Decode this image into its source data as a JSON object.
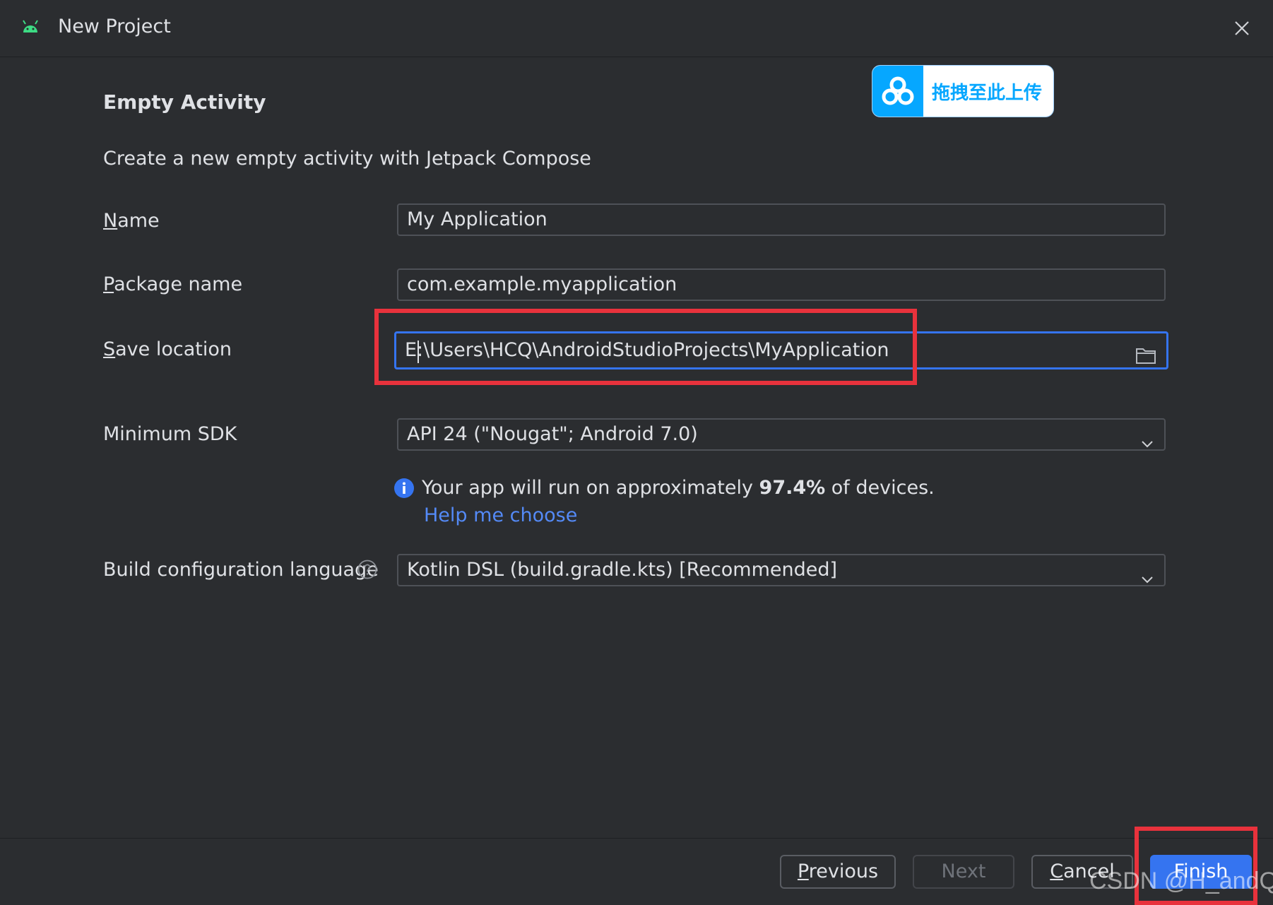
{
  "window": {
    "title": "New Project"
  },
  "template": {
    "title": "Empty Activity",
    "description": "Create a new empty activity with Jetpack Compose"
  },
  "form": {
    "name": {
      "label_first": "N",
      "label_rest": "ame",
      "value": "My Application"
    },
    "package": {
      "label_first": "P",
      "label_rest": "ackage name",
      "value": "com.example.myapplication"
    },
    "save_location": {
      "label_first": "S",
      "label_rest": "ave location",
      "value": "E:\\Users\\HCQ\\AndroidStudioProjects\\MyApplication"
    },
    "min_sdk": {
      "label": "Minimum SDK",
      "value": "API 24 (\"Nougat\"; Android 7.0)"
    },
    "build_config": {
      "label": "Build configuration language",
      "value": "Kotlin DSL (build.gradle.kts) [Recommended]"
    }
  },
  "info": {
    "text_before": "Your app will run on approximately ",
    "percent": "97.4%",
    "text_after": " of devices.",
    "help_link": "Help me choose"
  },
  "buttons": {
    "previous_first": "P",
    "previous_rest": "revious",
    "next": "Next",
    "cancel_first": "C",
    "cancel_rest": "ancel",
    "finish": "Finish"
  },
  "overlay": {
    "upload_label": "拖拽至此上传",
    "watermark": "CSDN @H_andQ"
  },
  "colors": {
    "background": "#2b2d30",
    "accent": "#3574f0",
    "link": "#548af7",
    "annotation_red": "#e8323c",
    "upload_blue": "#06a7ff"
  },
  "icons": [
    "android-icon",
    "close-icon",
    "folder-icon",
    "chevron-down-icon",
    "info-icon",
    "help-icon",
    "cloud-upload-icon"
  ]
}
